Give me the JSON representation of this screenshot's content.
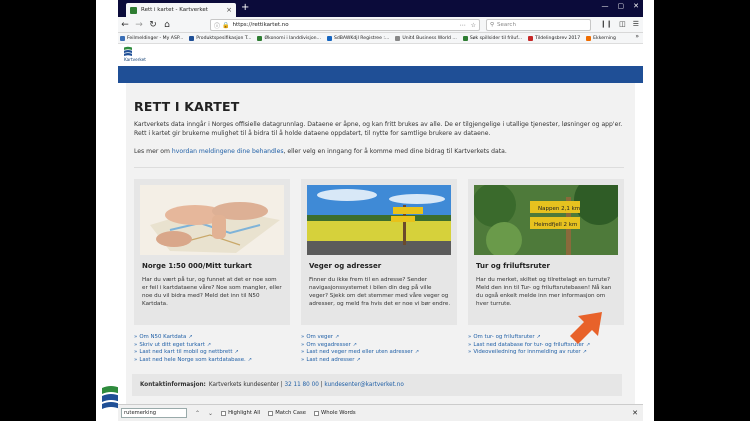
{
  "browser": {
    "tab_title": "Rett i kartet - Kartverket",
    "tab_close": "×",
    "new_tab": "+",
    "url": "https://rettikartet.no",
    "search_placeholder": "Search",
    "bookmarks": [
      {
        "label": "Feilmeldinger - My ASP...",
        "color": "#3b6fb6"
      },
      {
        "label": "Produktspesifikasjon T...",
        "color": "#1f4f96"
      },
      {
        "label": "Økonomi i landdivisjon...",
        "color": "#2e7d32"
      },
      {
        "label": "SdBAWKdjl Registree :...",
        "color": "#1565c0"
      },
      {
        "label": "Unit4 Business World ...",
        "color": "#888888"
      },
      {
        "label": "Søk spillsider til friluf...",
        "color": "#2e7d32"
      },
      {
        "label": "Tildelingsbrev 2017",
        "color": "#c62828"
      },
      {
        "label": "Ekkerning",
        "color": "#ef6c00"
      }
    ],
    "bookmarks_more": "»"
  },
  "site": {
    "logo_text": "Kartverket",
    "heading": "RETT I KARTET",
    "intro": "Kartverkets data inngår i Norges offisielle datagrunnlag. Dataene er åpne, og kan fritt brukes av alle. De er tilgjengelige i utallige tjenester, løsninger og app'er. Rett i kartet gir brukerne mulighet til å bidra til å holde dataene oppdatert, til nytte for samtlige brukere av dataene.",
    "more_prefix": "Les mer om ",
    "more_link": "hvordan meldingene dine behandles",
    "more_suffix": ", eller velg en inngang for å komme med dine bidrag til Kartverkets data."
  },
  "cards": [
    {
      "title": "Norge 1:50 000/Mitt turkart",
      "desc": "Har du vært på tur, og funnet at det er noe som er feil i kartdataene våre? Noe som mangler, eller noe du vil bidra med? Meld det inn til N50 Kartdata.",
      "links": [
        "Om N50 Kartdata",
        "Skriv ut ditt eget turkart",
        "Last ned kart til mobil og nettbrett",
        "Last ned hele Norge som kartdatabase."
      ]
    },
    {
      "title": "Veger og adresser",
      "desc": "Finner du ikke frem til en adresse? Sender navigasjonssystemet i bilen din deg på ville veger? Sjekk om det stemmer med våre veger og adresser, og meld fra hvis det er noe vi bør endre.",
      "links": [
        "Om veger",
        "Om vegadresser",
        "Last ned veger med eller uten adresser",
        "Last ned adresser"
      ]
    },
    {
      "title": "Tur og friluftsruter",
      "desc": "Har du merket, skiltet og tilrettelagt en turrute? Meld den inn til Tur- og friluftsrutebasen! Nå kan du også enkelt melde inn mer informasjon om hver turrute.",
      "links": [
        "Om tur- og friluftsruter",
        "Last ned database for tur- og friluftsruter",
        "Videoveiledning for innmelding av ruter"
      ],
      "sign_top": "Nappen 2,1 km",
      "sign_bottom": "Heimdfjell 2 km"
    }
  ],
  "contact": {
    "label": "Kontaktinformasjon:",
    "org": "Kartverkets kundesenter",
    "sep1": "|",
    "phone": "32 11 80 00",
    "sep2": "|",
    "email": "kundesenter@kartverket.no"
  },
  "findbar": {
    "value": "rutemerking",
    "highlight": "Highlight All",
    "match_case": "Match Case",
    "whole_words": "Whole Words"
  },
  "colors": {
    "brand_blue": "#1f4f96",
    "link": "#1f5fa6",
    "arrow": "#e8622a"
  }
}
